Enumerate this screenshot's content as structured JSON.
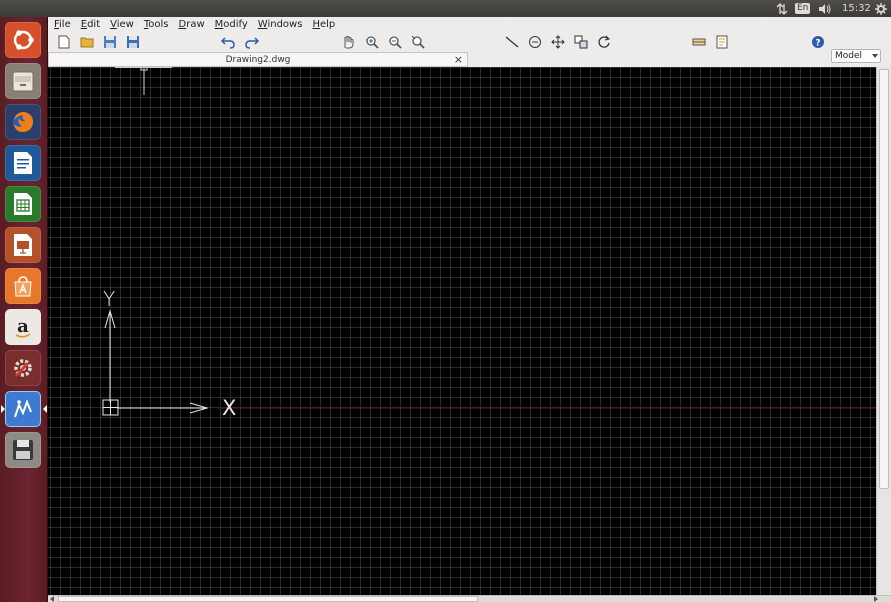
{
  "system_panel": {
    "keyboard_layout": "En",
    "time": "15:32",
    "icons": [
      "network-transfer-icon",
      "keyboard-layout-icon",
      "volume-icon",
      "power-gear-icon"
    ]
  },
  "launcher": {
    "items": [
      {
        "name": "ubuntu-dash"
      },
      {
        "name": "files"
      },
      {
        "name": "firefox"
      },
      {
        "name": "libreoffice-writer"
      },
      {
        "name": "libreoffice-calc"
      },
      {
        "name": "libreoffice-impress"
      },
      {
        "name": "ubuntu-software"
      },
      {
        "name": "amazon"
      },
      {
        "name": "system-settings"
      },
      {
        "name": "cad-app"
      },
      {
        "name": "save-disk"
      }
    ]
  },
  "menubar": {
    "items": [
      "File",
      "Edit",
      "View",
      "Tools",
      "Draw",
      "Modify",
      "Windows",
      "Help"
    ]
  },
  "toolbar": {
    "buttons": [
      "new-icon",
      "open-folder-icon",
      "save-icon",
      "save-as-icon",
      "undo-icon",
      "redo-icon",
      "pan-hand-icon",
      "zoom-in-icon",
      "zoom-out-icon",
      "zoom-extents-icon",
      "line-icon",
      "circle-icon",
      "move-icon",
      "copy-icon",
      "rotate-icon",
      "layer-icon",
      "properties-icon",
      "help-icon"
    ],
    "space_select": "Model"
  },
  "document": {
    "tab_title": "Drawing2.dwg",
    "close_glyph": "×"
  },
  "ucs": {
    "x_label": "X",
    "y_label": "Y"
  },
  "colors": {
    "canvas": "#000000",
    "launcher": "#6b2430",
    "axis_line": "#5a1a1a",
    "ucs": "#e8e8e8",
    "accent_cad": "#3d7bd1"
  }
}
